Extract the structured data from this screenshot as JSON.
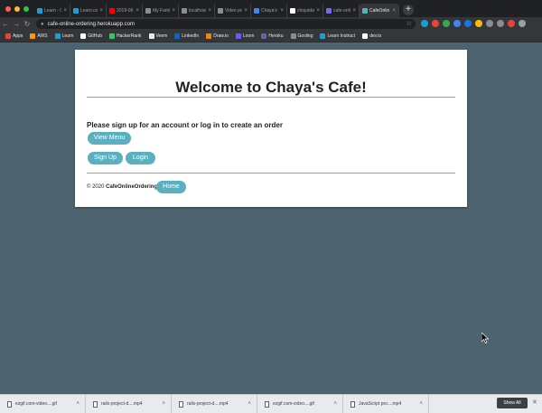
{
  "browser": {
    "tabs": [
      {
        "label": "Learn - Cl",
        "color": "#1a9fd6"
      },
      {
        "label": "Learn.co",
        "color": "#1a9fd6"
      },
      {
        "label": "2019-06",
        "color": "#ff0000"
      },
      {
        "label": "My Famil",
        "color": "#8a8d91"
      },
      {
        "label": "localhost",
        "color": "#8a8d91"
      },
      {
        "label": "Video pro",
        "color": "#8a8d91"
      },
      {
        "label": "Chaya's",
        "color": "#4285f4"
      },
      {
        "label": "chayadas",
        "color": "#ffffff"
      },
      {
        "label": "cafe-onli",
        "color": "#7b68ee"
      },
      {
        "label": "CafeOnlin",
        "color": "#5ab0c0"
      }
    ],
    "url": "cafe-online-ordering.herokuapp.com",
    "bookmarks": [
      {
        "label": "Apps",
        "color": "#ea4335"
      },
      {
        "label": "AWS",
        "color": "#ff9900"
      },
      {
        "label": "Learn",
        "color": "#1a9fd6"
      },
      {
        "label": "GitHub",
        "color": "#ffffff"
      },
      {
        "label": "HackerRank",
        "color": "#2ec866"
      },
      {
        "label": "Veem",
        "color": "#e8eaed"
      },
      {
        "label": "LinkedIn",
        "color": "#0a66c2"
      },
      {
        "label": "Draw.io",
        "color": "#f08705"
      },
      {
        "label": "Loom",
        "color": "#625df5"
      },
      {
        "label": "Heroku",
        "color": "#6762a6"
      },
      {
        "label": "Gosling",
        "color": "#8a8d91"
      },
      {
        "label": "Learn Instruct",
        "color": "#1a9fd6"
      },
      {
        "label": "dev.to",
        "color": "#ffffff"
      }
    ]
  },
  "page": {
    "title": "Welcome to Chaya's Cafe!",
    "prompt": "Please sign up for an account or log in to create an order",
    "view_menu": "View Menu",
    "sign_up": "Sign Up",
    "login": "Login",
    "footer_prefix": "© 2020",
    "footer_brand": "CafeOnlineOrdering",
    "home": "Home"
  },
  "downloads": {
    "items": [
      "ezgif.com-video....gif",
      "rails-project-d....mp4",
      "rails-project-d....mp4",
      "ezgif.com-video....gif",
      "JavaScript pro....mp4"
    ],
    "show_all": "Show All"
  },
  "colors": {
    "accent": "#5ab0c0",
    "background": "#4d6470"
  }
}
